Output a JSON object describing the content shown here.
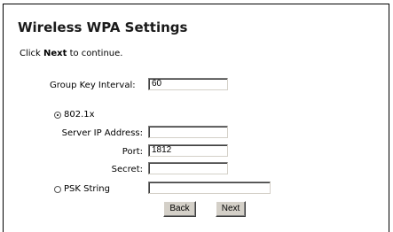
{
  "page": {
    "title": "Wireless WPA Settings",
    "instruction_prefix": "Click ",
    "instruction_bold": "Next",
    "instruction_suffix": " to continue."
  },
  "form": {
    "group_key_interval": {
      "label": "Group Key Interval:",
      "value": "60"
    },
    "radius_option": {
      "label": "802.1x",
      "selected": true
    },
    "server_ip": {
      "label": "Server IP Address:",
      "value": ""
    },
    "port": {
      "label": "Port:",
      "value": "1812"
    },
    "secret": {
      "label": "Secret:",
      "value": ""
    },
    "psk_option": {
      "label": "PSK String",
      "selected": false,
      "value": ""
    }
  },
  "buttons": {
    "back_label": "Back",
    "next_label": "Next"
  }
}
